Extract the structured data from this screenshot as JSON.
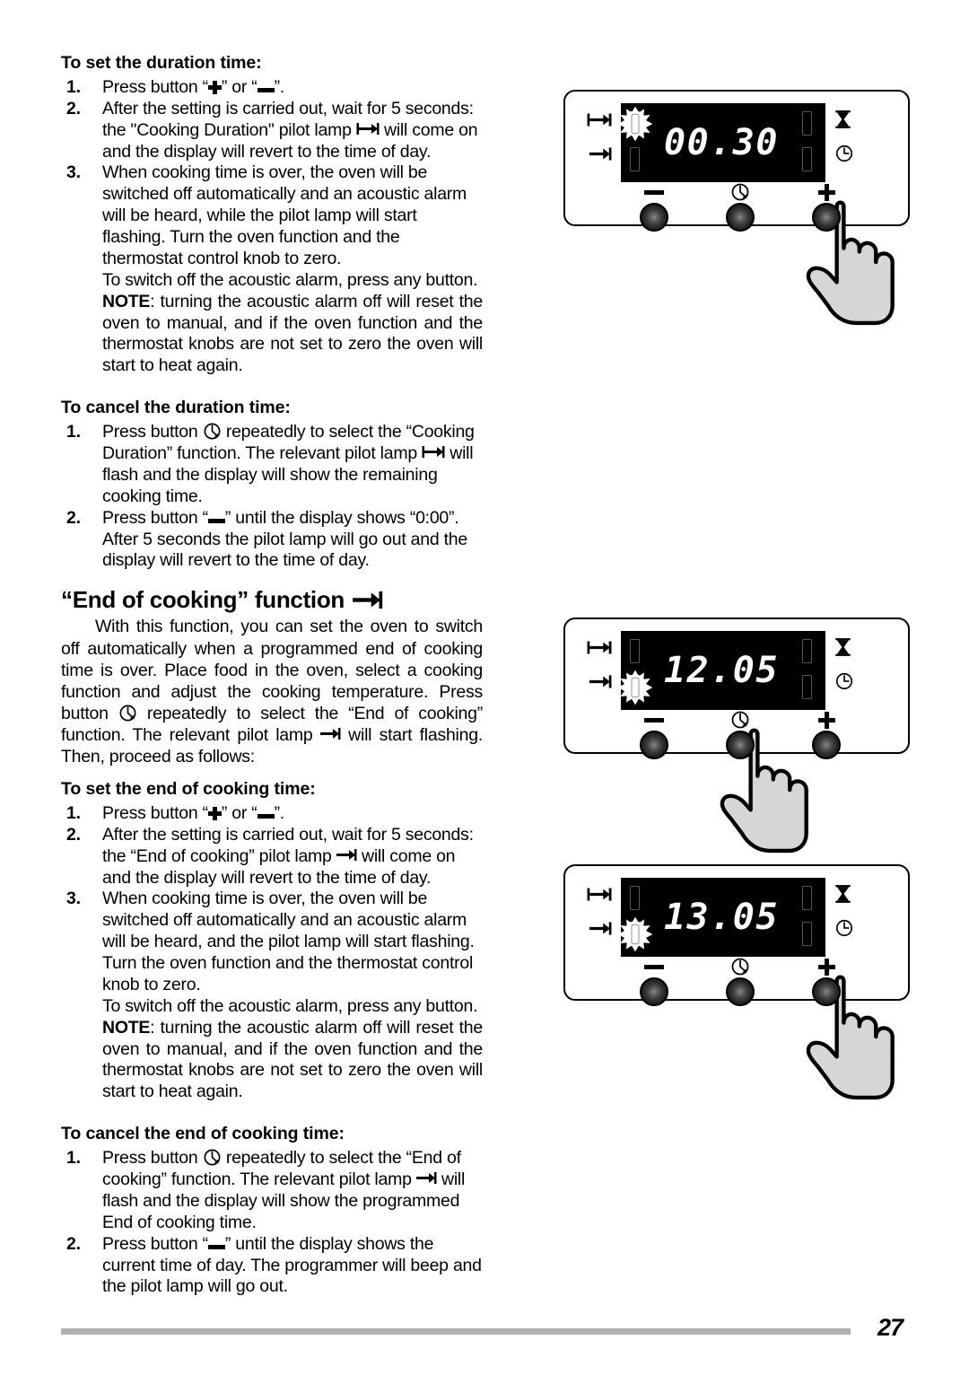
{
  "page": {
    "number": "27"
  },
  "sections": {
    "duration_set": {
      "heading": "To set the duration time:",
      "steps": [
        {
          "num": "1.",
          "pre": "Press button “",
          "icon_a": "plus-icon",
          "mid": "” or “",
          "icon_b": "minus-icon",
          "post": "”."
        },
        {
          "num": "2.",
          "pre": "After the setting is carried out, wait for 5 seconds: the \"Cooking Duration\" pilot lamp ",
          "icon": "duration-lamp-icon",
          "post": " will come on and the display will revert to the time of day."
        },
        {
          "num": "3.",
          "text": "When cooking time is over, the oven will be switched off automatically and an acoustic alarm will be heard, while the pilot lamp will start flashing. Turn the oven function and the thermostat control knob to zero."
        }
      ],
      "alarm_line": "To switch off the acoustic alarm, press any button.",
      "note_label": "NOTE",
      "note_text": ": turning the acoustic alarm off will reset the oven to manual, and if the oven function and the thermostat knobs are not set to zero the oven will start to heat again."
    },
    "duration_cancel": {
      "heading": "To cancel the duration time:",
      "steps": [
        {
          "num": "1.",
          "pre": "Press button ",
          "icon_a": "clock-selector-icon",
          "mid": " repeatedly to select the “Cooking Duration” function. The relevant pilot lamp ",
          "icon_b": "duration-lamp-icon",
          "post": " will flash and the display will show the remaining cooking time."
        },
        {
          "num": "2.",
          "pre": "Press button “",
          "icon_a": "minus-icon",
          "post": "” until the display shows “0:00”. After 5 seconds the pilot lamp will go out and the display will revert to the time of day."
        }
      ]
    },
    "end_of_cooking": {
      "heading": "“End of cooking” function",
      "heading_icon": "end-of-cooking-lamp-icon",
      "para_1": "With this function, you can set the oven to switch off automatically when a programmed end of cooking time is over. Place food in the oven, select a cooking function and adjust the cooking temperature. Press button ",
      "para_1_icon": "clock-selector-icon",
      "para_2": " repeatedly to select  the “End of cooking” function. The relevant pilot lamp ",
      "para_2_icon": "end-of-cooking-lamp-icon",
      "para_3": " will start flashing.  Then, proceed as follows:"
    },
    "end_set": {
      "heading": "To set the end of cooking time:",
      "steps": [
        {
          "num": "1.",
          "pre": "Press button “",
          "icon_a": "plus-icon",
          "mid": "” or “",
          "icon_b": "minus-icon",
          "post": "”."
        },
        {
          "num": "2.",
          "pre": "After the setting is carried out, wait for 5 seconds: the “End of cooking” pilot lamp ",
          "icon": "end-of-cooking-lamp-icon",
          "post": " will come on and the display will revert to the time of day."
        },
        {
          "num": "3.",
          "text": "When cooking time is over, the oven will be switched off automatically and an acoustic alarm will be heard, and the pilot lamp will start flashing. Turn the oven function and the thermostat control knob to zero."
        }
      ],
      "alarm_line": "To switch off the acoustic alarm, press any button.",
      "note_label": "NOTE",
      "note_text": ": turning the acoustic alarm off will reset the oven to manual, and if the oven function and the thermostat knobs are not set to zero the oven will start to heat again."
    },
    "end_cancel": {
      "heading": "To cancel the end of cooking time:",
      "steps": [
        {
          "num": "1.",
          "pre": "Press button ",
          "icon_a": "clock-selector-icon",
          "mid": " repeatedly to select  the “End of cooking” function. The relevant pilot lamp ",
          "icon_b": "end-of-cooking-lamp-icon",
          "post": "  will flash and the display will show the programmed End of cooking time."
        },
        {
          "num": "2.",
          "pre": "Press button “",
          "icon_a": "minus-icon",
          "post": "” until the display shows the current time of day. The programmer will beep and the pilot lamp will go out."
        }
      ]
    }
  },
  "figures": [
    {
      "id": "figure-duration-00-30",
      "display_value": "00.30",
      "lit_indicator": "duration",
      "pressed_button": "plus",
      "buttons": [
        "minus",
        "clock-selector",
        "plus"
      ],
      "left_icons": [
        "duration-lamp-icon",
        "end-of-cooking-lamp-icon"
      ],
      "right_icons": [
        "hourglass-icon",
        "clock-icon"
      ]
    },
    {
      "id": "figure-end-of-cooking-12-05",
      "display_value": "12.05",
      "lit_indicator": "end-of-cooking",
      "pressed_button": "clock-selector",
      "buttons": [
        "minus",
        "clock-selector",
        "plus"
      ],
      "left_icons": [
        "duration-lamp-icon",
        "end-of-cooking-lamp-icon"
      ],
      "right_icons": [
        "hourglass-icon",
        "clock-icon"
      ]
    },
    {
      "id": "figure-end-of-cooking-13-05",
      "display_value": "13.05",
      "lit_indicator": "end-of-cooking",
      "pressed_button": "plus",
      "buttons": [
        "minus",
        "clock-selector",
        "plus"
      ],
      "left_icons": [
        "duration-lamp-icon",
        "end-of-cooking-lamp-icon"
      ],
      "right_icons": [
        "hourglass-icon",
        "clock-icon"
      ]
    }
  ],
  "colors": {
    "text": "#000000",
    "screen_background": "#000000",
    "screen_digits": "#ffffff",
    "footer_rule": "#b0b0b0",
    "hand_fill": "#d8d8d8"
  }
}
